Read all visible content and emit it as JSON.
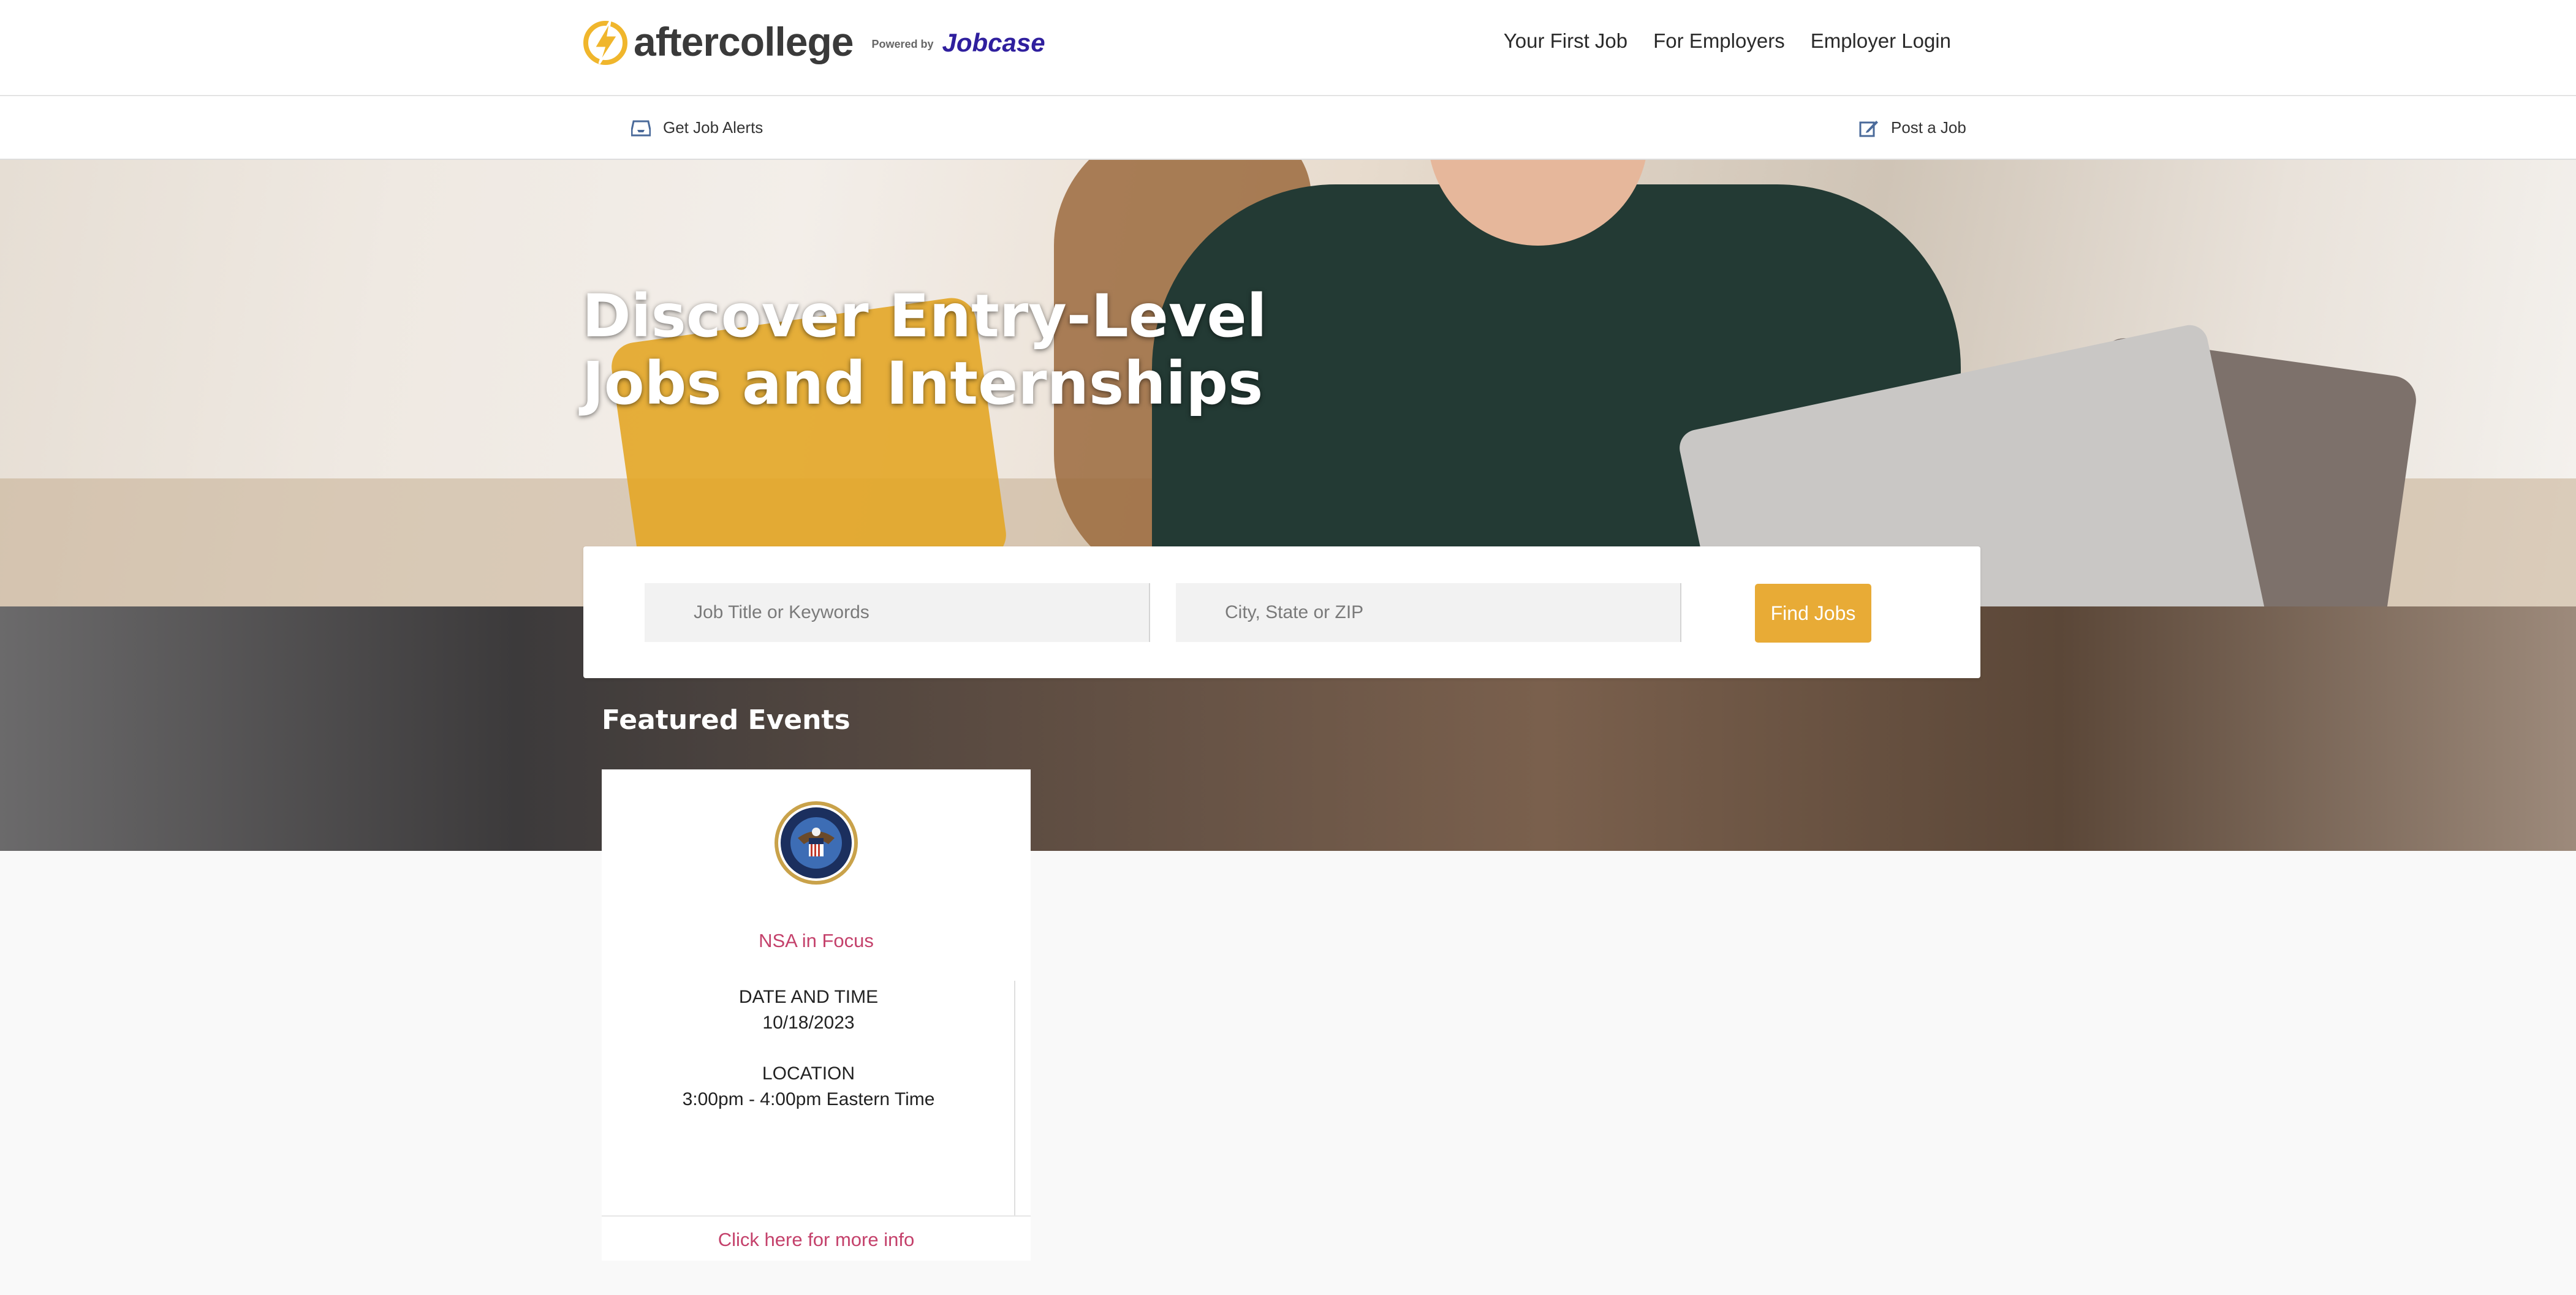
{
  "header": {
    "logo_text": "aftercollege",
    "powered_by": "Powered by",
    "partner": "Jobcase",
    "nav": [
      "Your First Job",
      "For Employers",
      "Employer Login"
    ]
  },
  "subbar": {
    "alerts_label": "Get Job Alerts",
    "post_label": "Post a Job"
  },
  "hero": {
    "title": "Discover Entry-Level Jobs and Internships"
  },
  "search": {
    "job_placeholder": "Job Title or Keywords",
    "location_placeholder": "City, State or ZIP",
    "button_label": "Find Jobs"
  },
  "featured": {
    "title": "Featured Events",
    "event": {
      "name": "NSA in Focus",
      "date_label": "DATE AND TIME",
      "date_value": "10/18/2023",
      "location_label": "LOCATION",
      "location_value": "3:00pm - 4:00pm Eastern Time",
      "link_label": "Click here for more info"
    }
  },
  "colors": {
    "accent": "#e8ab36",
    "link": "#c4416b",
    "partner": "#2f1f9e"
  }
}
